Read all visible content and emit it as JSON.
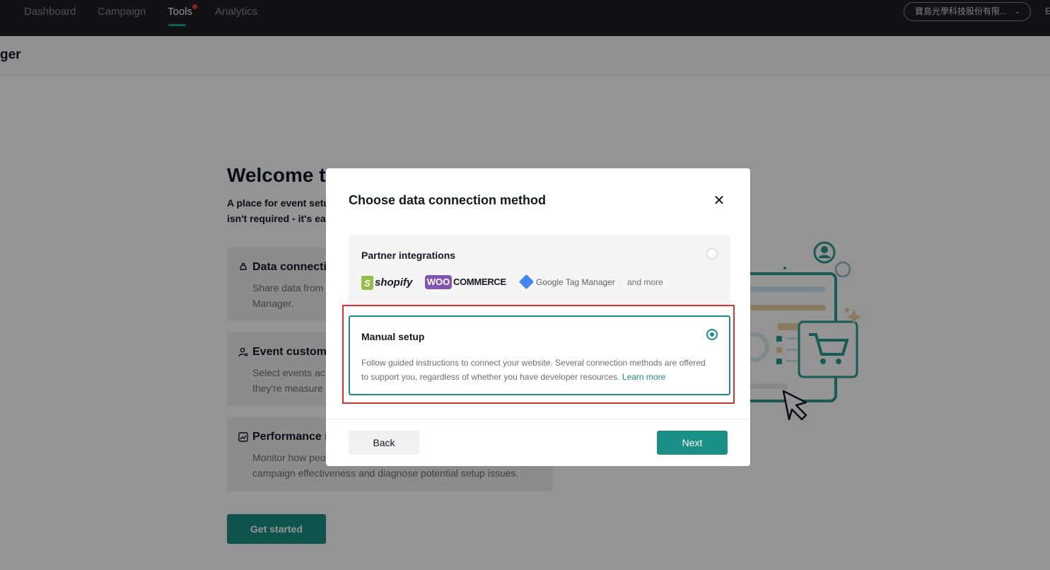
{
  "nav": {
    "items": [
      "Dashboard",
      "Campaign",
      "Tools",
      "Analytics"
    ],
    "active": "Tools",
    "account_label": "寶島光學科技股份有限...",
    "language_label": "E"
  },
  "page": {
    "title": "ger"
  },
  "welcome": {
    "title": "Welcome t",
    "subtitle_line1": "A place for event setu",
    "subtitle_line2": "isn't required - it's ea",
    "features": [
      {
        "title": "Data connecti",
        "desc_line1": "Share data from",
        "desc_line2": "Manager."
      },
      {
        "title": "Event customi",
        "desc_line1": "Select events ac",
        "desc_line2": "they're measure"
      },
      {
        "title": "Performance i",
        "desc_line1": "Monitor how peo",
        "desc_line2": "campaign effectiveness and diagnose potential setup issues."
      }
    ],
    "get_started_label": "Get started"
  },
  "modal": {
    "title": "Choose data connection method",
    "close_icon": "✕",
    "partner": {
      "title": "Partner integrations",
      "selected": false,
      "logos": {
        "shopify": "shopify",
        "woo_prefix": "WOO",
        "woo_suffix": "COMMERCE",
        "gtm": "Google Tag Manager",
        "and_more": "and more"
      }
    },
    "manual": {
      "title": "Manual setup",
      "selected": true,
      "description": "Follow guided instructions to connect your website. Several connection methods are offered to support you, regardless of whether you have developer resources.",
      "learn_more": "Learn more"
    },
    "back_label": "Back",
    "next_label": "Next"
  },
  "colors": {
    "accent": "#1a8f85",
    "highlight": "#e5302a",
    "nav_bg": "#1f2023"
  }
}
